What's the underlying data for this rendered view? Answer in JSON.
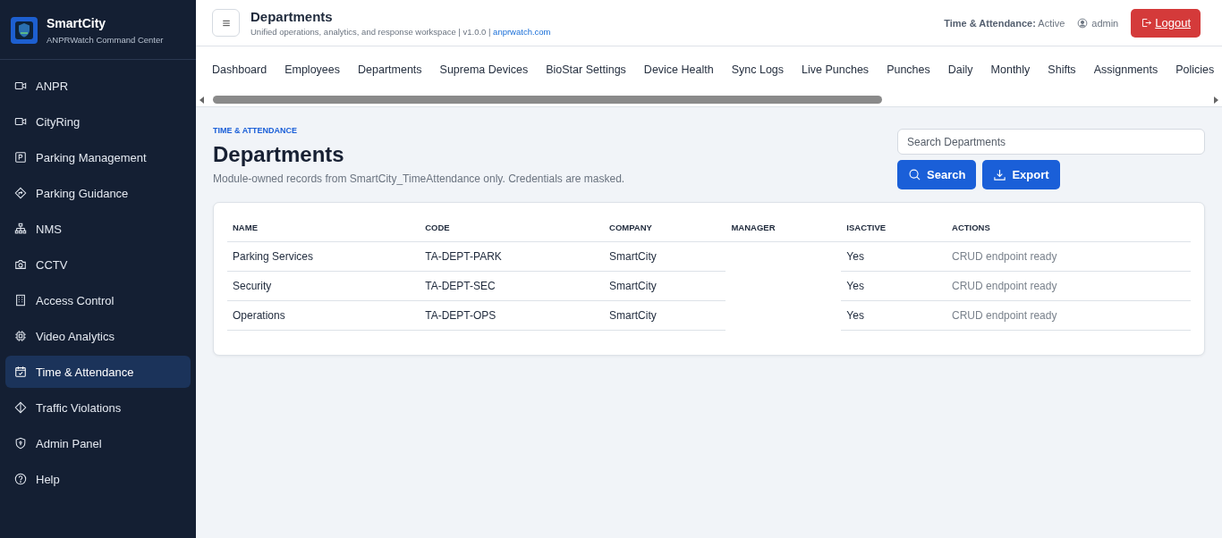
{
  "sidebar": {
    "brand": "SmartCity",
    "subtitle": "ANPRWatch Command Center",
    "items": [
      {
        "label": "ANPR",
        "selected": false
      },
      {
        "label": "CityRing",
        "selected": false
      },
      {
        "label": "Parking Management",
        "selected": false
      },
      {
        "label": "Parking Guidance",
        "selected": false
      },
      {
        "label": "NMS",
        "selected": false
      },
      {
        "label": "CCTV",
        "selected": false
      },
      {
        "label": "Access Control",
        "selected": false
      },
      {
        "label": "Video Analytics",
        "selected": false
      },
      {
        "label": "Time & Attendance",
        "selected": true
      },
      {
        "label": "Traffic Violations",
        "selected": false
      },
      {
        "label": "Admin Panel",
        "selected": false
      },
      {
        "label": "Help",
        "selected": false
      }
    ]
  },
  "topbar": {
    "title": "Departments",
    "subtitle": "Unified operations, analytics, and response workspace | v1.0.0 |",
    "link": "anprwatch.com",
    "status": "**Time & Attendance:** Active",
    "user": "admin",
    "logout": "Logout"
  },
  "tabs": [
    {
      "label": "Dashboard",
      "selected": false
    },
    {
      "label": "Employees",
      "selected": false
    },
    {
      "label": "Departments",
      "selected": false
    },
    {
      "label": "Suprema Devices",
      "selected": false
    },
    {
      "label": "BioStar Settings",
      "selected": false
    },
    {
      "label": "Device Health",
      "selected": false
    },
    {
      "label": "Sync Logs",
      "selected": false
    },
    {
      "label": "Live Punches",
      "selected": false
    },
    {
      "label": "Punches",
      "selected": false
    },
    {
      "label": "Daily",
      "selected": false
    },
    {
      "label": "Monthly",
      "selected": false
    },
    {
      "label": "Shifts",
      "selected": false
    },
    {
      "label": "Assignments",
      "selected": false
    },
    {
      "label": "Policies",
      "selected": false
    }
  ],
  "page": {
    "eyebrow": "TIME & ATTENDANCE",
    "title": "Departments",
    "description": "Module-owned records from SmartCity_TimeAttendance only. Credentials are masked.",
    "search": {
      "placeholder": "Search Departments"
    },
    "buttons": [
      "Search",
      "Export"
    ]
  },
  "table": {
    "columns": [
      "NAME",
      "CODE",
      "COMPANY",
      "MANAGER",
      "ISACTIVE",
      "ACTIONS"
    ],
    "rows": [
      [
        "Parking Services",
        "TA-DEPT-PARK",
        "SmartCity",
        "",
        "Yes",
        "CRUD endpoint ready"
      ],
      [
        "Security",
        "TA-DEPT-SEC",
        "SmartCity",
        "",
        "Yes",
        "CRUD endpoint ready"
      ],
      [
        "Operations",
        "TA-DEPT-OPS",
        "SmartCity",
        "",
        "Yes",
        "CRUD endpoint ready"
      ]
    ]
  }
}
